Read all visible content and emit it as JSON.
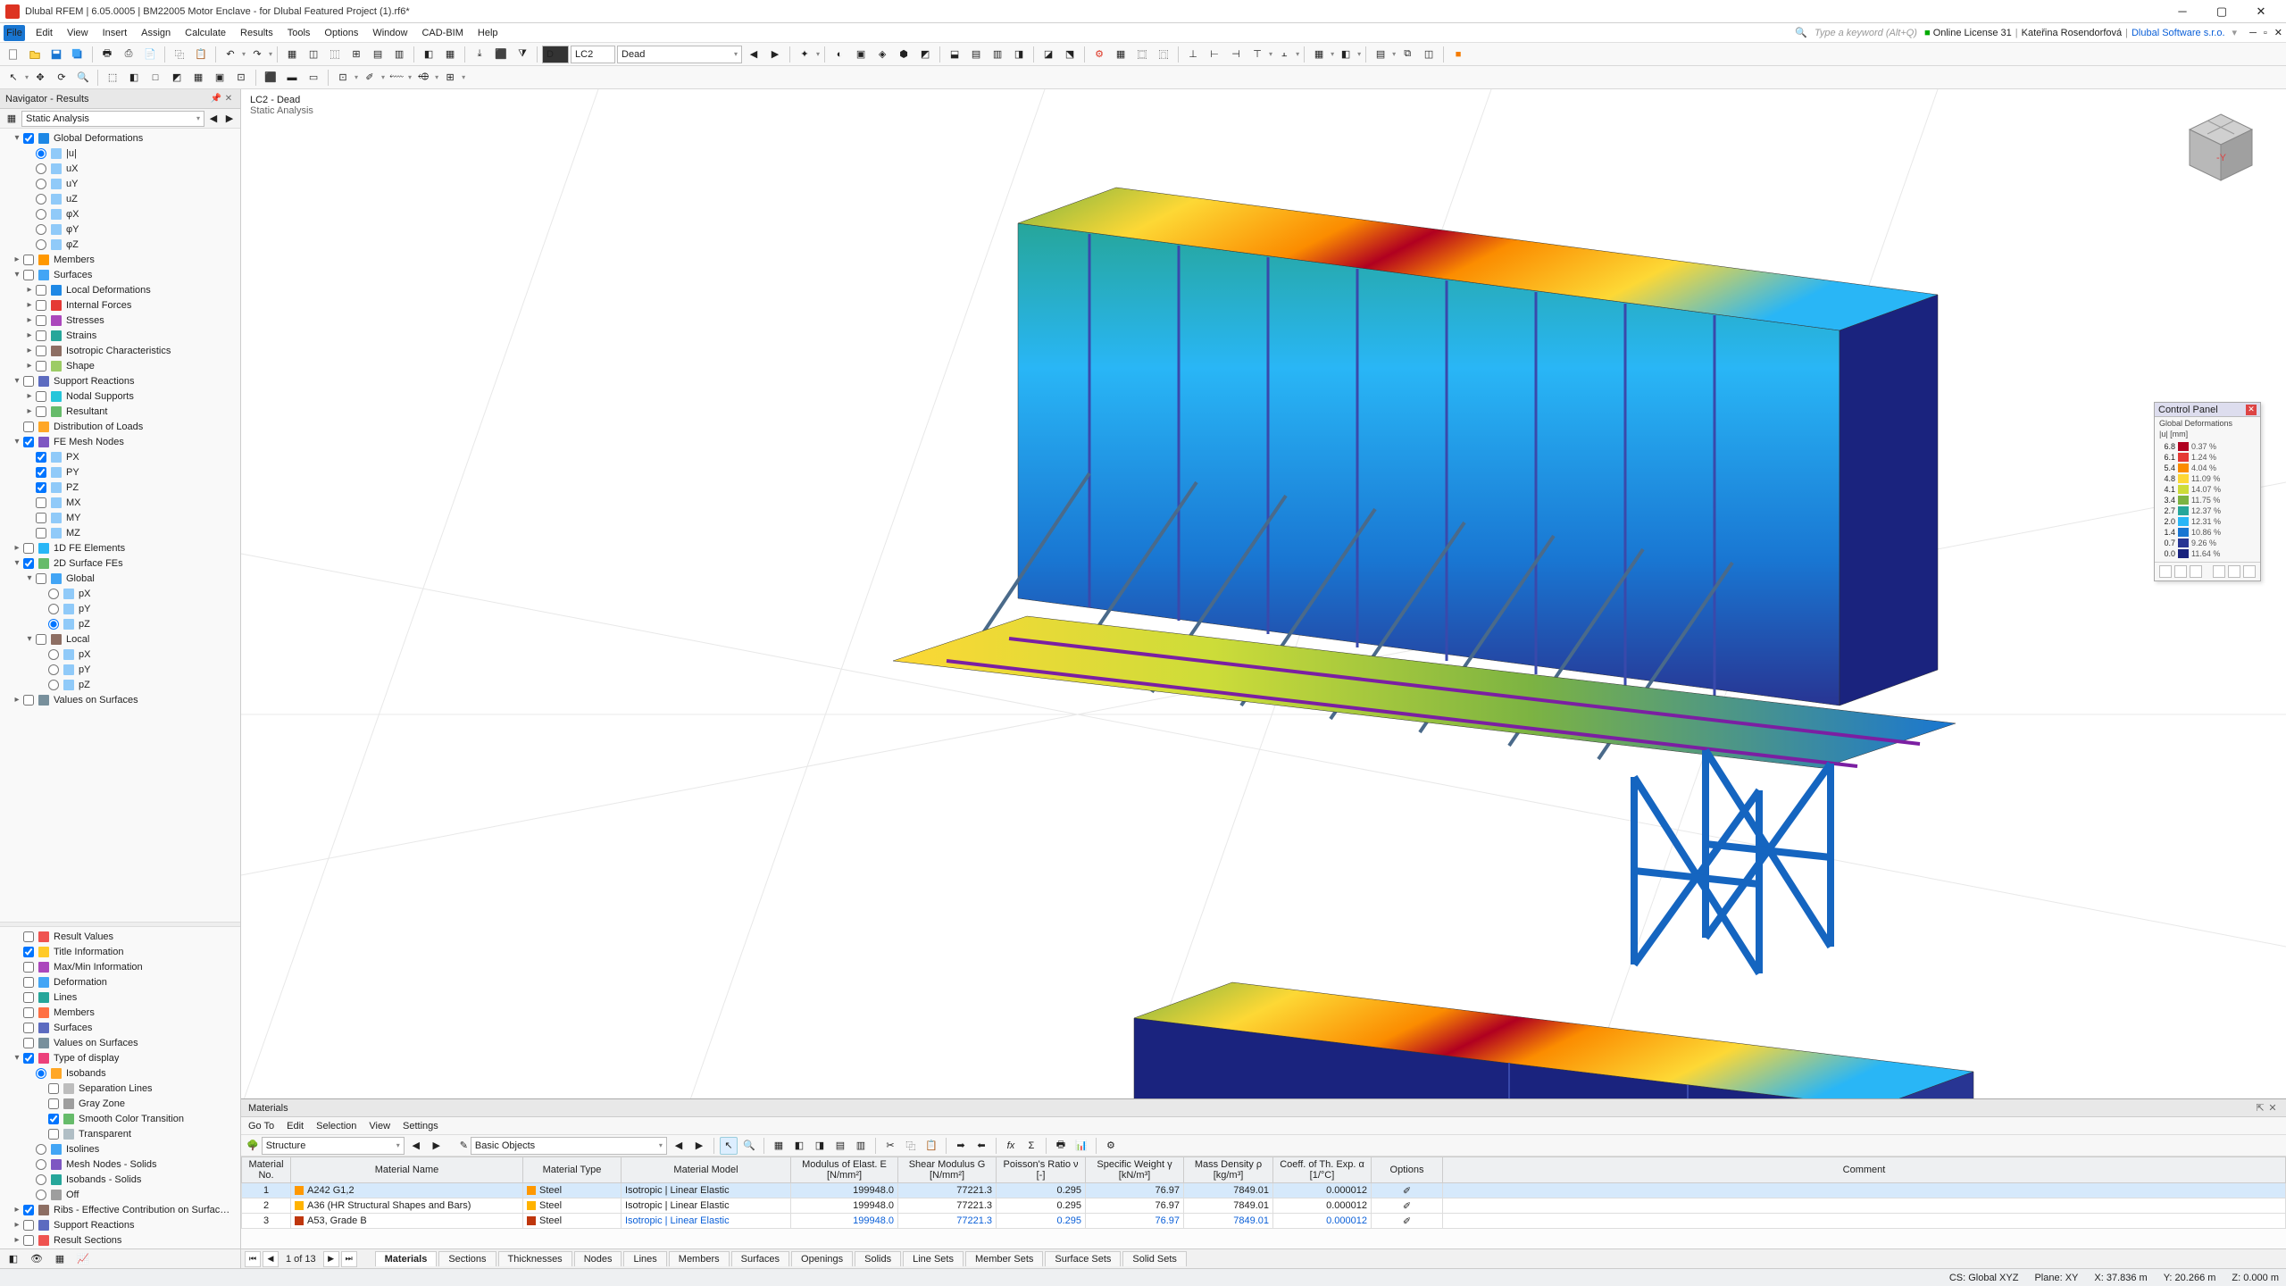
{
  "app": {
    "icon": "D",
    "title": "Dlubal RFEM | 6.05.0005 | BM22005 Motor Enclave - for Dlubal Featured Project (1).rf6*"
  },
  "menu": {
    "file_label": "File",
    "items": [
      "Edit",
      "View",
      "Insert",
      "Assign",
      "Calculate",
      "Results",
      "Tools",
      "Options",
      "Window",
      "CAD-BIM",
      "Help"
    ],
    "search_hint": "Type a keyword (Alt+Q)",
    "license_label": "Online License 31",
    "user_name": "Kateřina Rosendorfová",
    "company": "Dlubal Software s.r.o."
  },
  "toolbar1": {
    "lc_field": "LC2",
    "load_field": "Dead",
    "d_prefix": "D"
  },
  "navigator": {
    "title": "Navigator - Results",
    "static_label": "Static Analysis",
    "tree": [
      {
        "l": 0,
        "exp": "▾",
        "chk": true,
        "ico": "blue",
        "txt": "Global Deformations"
      },
      {
        "l": 1,
        "rad": true,
        "sel": true,
        "ico": "box",
        "txt": "|u|"
      },
      {
        "l": 1,
        "rad": true,
        "ico": "box",
        "txt": "uX"
      },
      {
        "l": 1,
        "rad": true,
        "ico": "box",
        "txt": "uY"
      },
      {
        "l": 1,
        "rad": true,
        "ico": "box",
        "txt": "uZ"
      },
      {
        "l": 1,
        "rad": true,
        "ico": "box",
        "txt": "φX"
      },
      {
        "l": 1,
        "rad": true,
        "ico": "box",
        "txt": "φY"
      },
      {
        "l": 1,
        "rad": true,
        "ico": "box",
        "txt": "φZ"
      },
      {
        "l": 0,
        "exp": "▸",
        "chk": false,
        "ico": "bar",
        "txt": "Members"
      },
      {
        "l": 0,
        "exp": "▾",
        "chk": false,
        "ico": "surf",
        "txt": "Surfaces"
      },
      {
        "l": 1,
        "exp": "▸",
        "chk": false,
        "ico": "blue",
        "txt": "Local Deformations"
      },
      {
        "l": 1,
        "exp": "▸",
        "chk": false,
        "ico": "red",
        "txt": "Internal Forces"
      },
      {
        "l": 1,
        "exp": "▸",
        "chk": false,
        "ico": "mag",
        "txt": "Stresses"
      },
      {
        "l": 1,
        "exp": "▸",
        "chk": false,
        "ico": "teal",
        "txt": "Strains"
      },
      {
        "l": 1,
        "exp": "▸",
        "chk": false,
        "ico": "brn",
        "txt": "Isotropic Characteristics"
      },
      {
        "l": 1,
        "exp": "▸",
        "chk": false,
        "ico": "shp",
        "txt": "Shape"
      },
      {
        "l": 0,
        "exp": "▾",
        "chk": false,
        "ico": "sup",
        "txt": "Support Reactions"
      },
      {
        "l": 1,
        "exp": "▸",
        "chk": false,
        "ico": "nod",
        "txt": "Nodal Supports"
      },
      {
        "l": 1,
        "exp": "▸",
        "chk": false,
        "ico": "res",
        "txt": "Resultant"
      },
      {
        "l": 0,
        "exp": "",
        "chk": false,
        "ico": "dist",
        "txt": "Distribution of Loads"
      },
      {
        "l": 0,
        "exp": "▾",
        "chk": true,
        "ico": "mesh",
        "txt": "FE Mesh Nodes"
      },
      {
        "l": 1,
        "chk": true,
        "ico": "box",
        "txt": "PX"
      },
      {
        "l": 1,
        "chk": true,
        "ico": "box",
        "txt": "PY"
      },
      {
        "l": 1,
        "chk": true,
        "ico": "box",
        "txt": "PZ"
      },
      {
        "l": 1,
        "chk": false,
        "ico": "box",
        "txt": "MX"
      },
      {
        "l": 1,
        "chk": false,
        "ico": "box",
        "txt": "MY"
      },
      {
        "l": 1,
        "chk": false,
        "ico": "box",
        "txt": "MZ"
      },
      {
        "l": 0,
        "exp": "▸",
        "chk": false,
        "ico": "1d",
        "txt": "1D FE Elements"
      },
      {
        "l": 0,
        "exp": "▾",
        "chk": true,
        "ico": "2d",
        "txt": "2D Surface FEs"
      },
      {
        "l": 1,
        "exp": "▾",
        "chk": false,
        "ico": "glb",
        "txt": "Global"
      },
      {
        "l": 2,
        "rad": true,
        "ico": "box",
        "txt": "pX"
      },
      {
        "l": 2,
        "rad": true,
        "ico": "box",
        "txt": "pY"
      },
      {
        "l": 2,
        "rad": true,
        "sel": true,
        "ico": "box",
        "txt": "pZ"
      },
      {
        "l": 1,
        "exp": "▾",
        "chk": false,
        "ico": "loc",
        "txt": "Local"
      },
      {
        "l": 2,
        "rad": true,
        "ico": "box",
        "txt": "pX"
      },
      {
        "l": 2,
        "rad": true,
        "ico": "box",
        "txt": "pY"
      },
      {
        "l": 2,
        "rad": true,
        "ico": "box",
        "txt": "pZ"
      },
      {
        "l": 0,
        "exp": "▸",
        "chk": false,
        "ico": "val",
        "txt": "Values on Surfaces"
      }
    ],
    "bottom_tree": [
      {
        "l": 0,
        "chk": false,
        "ico": "rv",
        "txt": "Result Values"
      },
      {
        "l": 0,
        "chk": true,
        "ico": "ti",
        "txt": "Title Information"
      },
      {
        "l": 0,
        "chk": false,
        "ico": "mm",
        "txt": "Max/Min Information"
      },
      {
        "l": 0,
        "chk": false,
        "ico": "df",
        "txt": "Deformation"
      },
      {
        "l": 0,
        "chk": false,
        "ico": "ln",
        "txt": "Lines"
      },
      {
        "l": 0,
        "chk": false,
        "ico": "mb",
        "txt": "Members"
      },
      {
        "l": 0,
        "chk": false,
        "ico": "sf",
        "txt": "Surfaces"
      },
      {
        "l": 0,
        "chk": false,
        "ico": "vs",
        "txt": "Values on Surfaces"
      },
      {
        "l": 0,
        "exp": "▾",
        "chk": true,
        "ico": "td",
        "txt": "Type of display"
      },
      {
        "l": 1,
        "rad": true,
        "sel": true,
        "ico": "iso",
        "txt": "Isobands"
      },
      {
        "l": 2,
        "chk": false,
        "ico": "sep",
        "txt": "Separation Lines"
      },
      {
        "l": 2,
        "chk": false,
        "ico": "gz",
        "txt": "Gray Zone"
      },
      {
        "l": 2,
        "chk": true,
        "ico": "sct",
        "txt": "Smooth Color Transition"
      },
      {
        "l": 2,
        "chk": false,
        "ico": "tr",
        "txt": "Transparent"
      },
      {
        "l": 1,
        "rad": true,
        "ico": "isl",
        "txt": "Isolines"
      },
      {
        "l": 1,
        "rad": true,
        "ico": "mns",
        "txt": "Mesh Nodes - Solids"
      },
      {
        "l": 1,
        "rad": true,
        "ico": "ibs",
        "txt": "Isobands - Solids"
      },
      {
        "l": 1,
        "rad": true,
        "ico": "off",
        "txt": "Off"
      },
      {
        "l": 0,
        "exp": "▸",
        "chk": true,
        "ico": "rib",
        "txt": "Ribs - Effective Contribution on Surfac…"
      },
      {
        "l": 0,
        "exp": "▸",
        "chk": false,
        "ico": "sr",
        "txt": "Support Reactions"
      },
      {
        "l": 0,
        "exp": "▸",
        "chk": false,
        "ico": "rs",
        "txt": "Result Sections"
      }
    ]
  },
  "viewport": {
    "lc_title": "LC2 - Dead",
    "subtitle": "Static Analysis"
  },
  "control_panel": {
    "title": "Control Panel",
    "subtitle": "Global Deformations",
    "unit": "|u| [mm]",
    "rows": [
      {
        "v": "6.8",
        "c": "#b00020",
        "p": "0.37 %"
      },
      {
        "v": "6.1",
        "c": "#e53935",
        "p": "1.24 %"
      },
      {
        "v": "5.4",
        "c": "#fb8c00",
        "p": "4.04 %"
      },
      {
        "v": "4.8",
        "c": "#fdd835",
        "p": "11.09 %"
      },
      {
        "v": "4.1",
        "c": "#cddc39",
        "p": "14.07 %"
      },
      {
        "v": "3.4",
        "c": "#7cb342",
        "p": "11.75 %"
      },
      {
        "v": "2.7",
        "c": "#26a69a",
        "p": "12.37 %"
      },
      {
        "v": "2.0",
        "c": "#29b6f6",
        "p": "12.31 %"
      },
      {
        "v": "1.4",
        "c": "#1976d2",
        "p": "10.86 %"
      },
      {
        "v": "0.7",
        "c": "#283593",
        "p": "9.26 %"
      },
      {
        "v": "0.0",
        "c": "#1a237e",
        "p": "11.64 %"
      }
    ]
  },
  "materials": {
    "title": "Materials",
    "menu": [
      "Go To",
      "Edit",
      "Selection",
      "View",
      "Settings"
    ],
    "structure_label": "Structure",
    "basic_label": "Basic Objects",
    "headers": {
      "no": "Material\nNo.",
      "name": "Material Name",
      "type": "Material\nType",
      "model": "Material Model",
      "modE": "Modulus of Elast.\nE [N/mm²]",
      "shearG": "Shear Modulus\nG [N/mm²]",
      "poisson": "Poisson's Ratio\nν [-]",
      "specW": "Specific Weight\nγ [kN/m³]",
      "massD": "Mass Density\nρ [kg/m³]",
      "coeff": "Coeff. of Th. Exp.\nα [1/°C]",
      "options": "Options",
      "comment": "Comment"
    },
    "rows": [
      {
        "no": "1",
        "sw": "#ff9800",
        "name": "A242 G1,2",
        "type": "Steel",
        "model": "Isotropic | Linear Elastic",
        "E": "199948.0",
        "G": "77221.3",
        "v": "0.295",
        "y": "76.97",
        "p": "7849.01",
        "a": "0.000012",
        "sel": true
      },
      {
        "no": "2",
        "sw": "#ffb300",
        "name": "A36 (HR Structural Shapes and Bars)",
        "type": "Steel",
        "model": "Isotropic | Linear Elastic",
        "E": "199948.0",
        "G": "77221.3",
        "v": "0.295",
        "y": "76.97",
        "p": "7849.01",
        "a": "0.000012"
      },
      {
        "no": "3",
        "sw": "#bf360c",
        "name": "A53, Grade B",
        "type": "Steel",
        "model": "Isotropic | Linear Elastic",
        "E": "199948.0",
        "G": "77221.3",
        "v": "0.295",
        "y": "76.97",
        "p": "7849.01",
        "a": "0.000012",
        "link": true
      }
    ],
    "nav_pos": "1 of 13",
    "tabs": [
      "Materials",
      "Sections",
      "Thicknesses",
      "Nodes",
      "Lines",
      "Members",
      "Surfaces",
      "Openings",
      "Solids",
      "Line Sets",
      "Member Sets",
      "Surface Sets",
      "Solid Sets"
    ],
    "active_tab": 0
  },
  "status": {
    "cs": "CS: Global XYZ",
    "plane": "Plane: XY",
    "x": "X: 37.836 m",
    "y": "Y: 20.266 m",
    "z": "Z: 0.000 m"
  }
}
